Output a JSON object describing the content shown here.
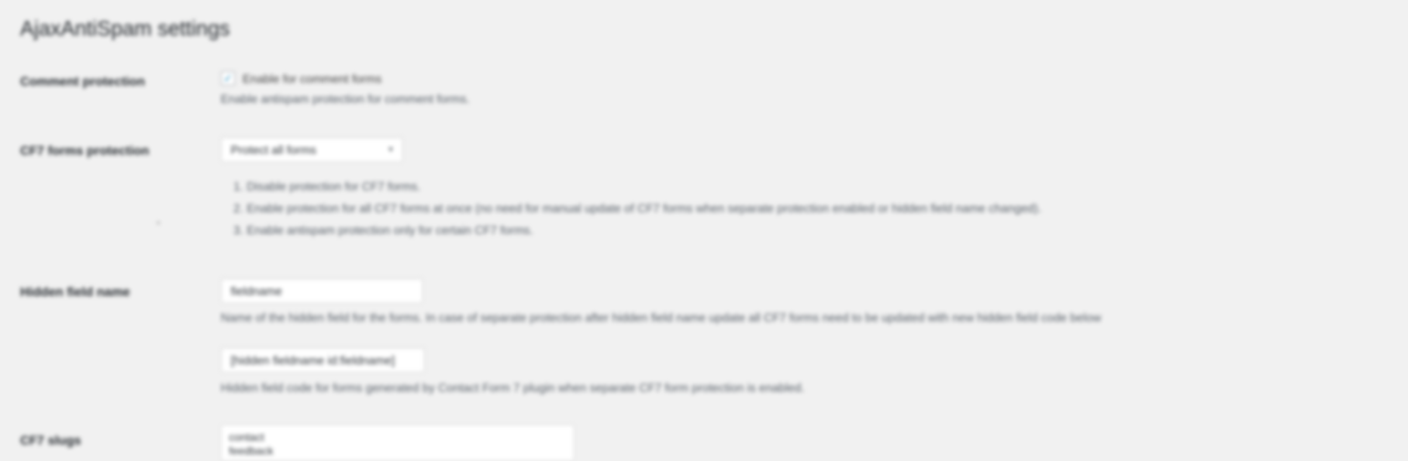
{
  "page": {
    "title": "AjaxAntiSpam settings"
  },
  "comment_protection": {
    "label": "Comment protection",
    "checkbox_label": "Enable for comment forms",
    "checked": true,
    "description": "Enable antispam protection for comment forms."
  },
  "cf7_protection": {
    "label": "CF7 forms protection",
    "selected": "Protect all forms",
    "options_help": [
      "1. Disable protection for CF7 forms.",
      "2. Enable protection for all CF7 forms at once (no need for manual update of CF7 forms when separate protection enabled or hidden field name changed).",
      "3. Enable antispam protection only for certain CF7 forms."
    ]
  },
  "hidden_field": {
    "label": "Hidden field name",
    "value": "fieldname",
    "description": "Name of the hidden field for the forms. In case of separate protection after hidden field name update all CF7 forms need to be updated with new hidden field code below",
    "code_value": "[hidden fieldname id:fieldname]",
    "code_description": "Hidden field code for forms generated by Contact Form 7 plugin when separate CF7 form protection is enabled."
  },
  "cf7_slugs": {
    "label": "CF7 slugs",
    "lines": [
      "contact",
      "feedback"
    ]
  }
}
